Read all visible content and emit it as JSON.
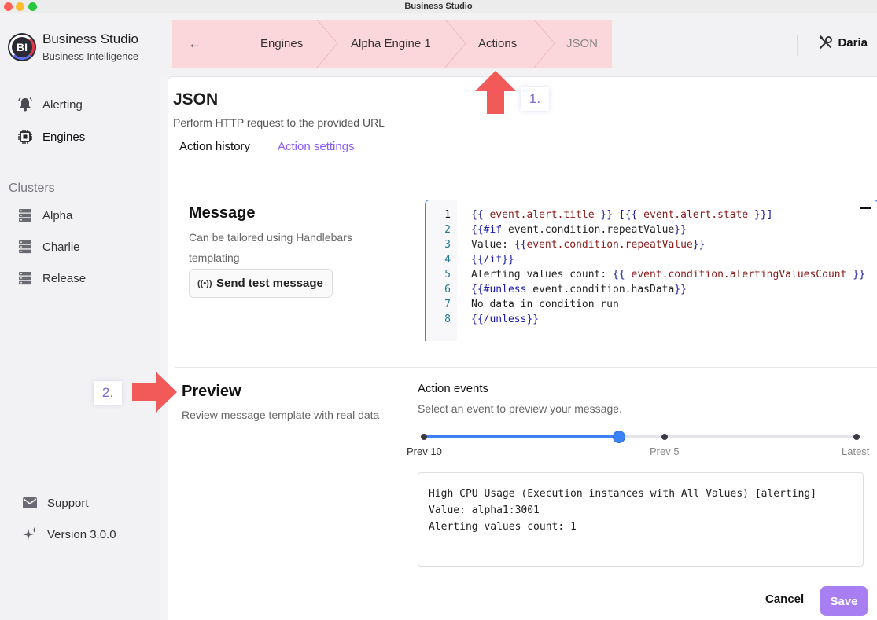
{
  "window": {
    "title": "Business Studio"
  },
  "brand": {
    "logo_text": "BI",
    "title": "Business Studio",
    "subtitle": "Business Intelligence"
  },
  "sidebar": {
    "items": [
      {
        "label": "Alerting",
        "icon": "bell-icon"
      },
      {
        "label": "Engines",
        "icon": "chip-icon"
      }
    ],
    "clusters_label": "Clusters",
    "clusters": [
      {
        "label": "Alpha",
        "icon": "server-icon"
      },
      {
        "label": "Charlie",
        "icon": "server-icon"
      },
      {
        "label": "Release",
        "icon": "server-icon"
      }
    ],
    "footer": [
      {
        "label": "Support",
        "icon": "mail-icon"
      },
      {
        "label": "Version 3.0.0",
        "icon": "sparkle-icon"
      }
    ]
  },
  "breadcrumb": {
    "back_icon": "arrow-left-icon",
    "items": [
      "Engines",
      "Alpha Engine 1",
      "Actions",
      "JSON"
    ],
    "highlight_color": "#fbd6da"
  },
  "user": {
    "name": "Daria",
    "icon": "tools-icon"
  },
  "page": {
    "title": "JSON",
    "description": "Perform HTTP request to the provided URL",
    "tabs": [
      {
        "label": "Action history",
        "active": false
      },
      {
        "label": "Action settings",
        "active": true
      }
    ]
  },
  "message": {
    "title": "Message",
    "description": "Can be tailored using Handlebars templating",
    "test_button": "Send test message",
    "code": [
      "{{ event.alert.title }} [{{ event.alert.state }}]",
      "{{#if event.condition.repeatValue}}",
      "Value: {{event.condition.repeatValue}}",
      "{{/if}}",
      "Alerting values count: {{ event.condition.alertingValuesCount }}",
      "{{#unless event.condition.hasData}}",
      "No data in condition run",
      "{{/unless}}"
    ],
    "line_numbers": [
      "1",
      "2",
      "3",
      "4",
      "5",
      "6",
      "7",
      "8"
    ]
  },
  "preview": {
    "title": "Preview",
    "description": "Review message template with real data",
    "events_title": "Action events",
    "events_description": "Select an event to preview your message.",
    "slider_labels": [
      "Prev 10",
      "Prev 5",
      "Latest"
    ],
    "slider_value_fraction": 0.45,
    "output": [
      "High CPU Usage (Execution instances with All Values) [alerting]",
      "Value: alpha1:3001",
      "Alerting values count: 1"
    ]
  },
  "actions": {
    "cancel": "Cancel",
    "save": "Save"
  },
  "annotations": [
    {
      "label": "1."
    },
    {
      "label": "2."
    }
  ],
  "colors": {
    "accent": "#8a5cf6",
    "save": "#a77ff2",
    "slider": "#3b82f6",
    "arrow": "#f25a5a"
  }
}
